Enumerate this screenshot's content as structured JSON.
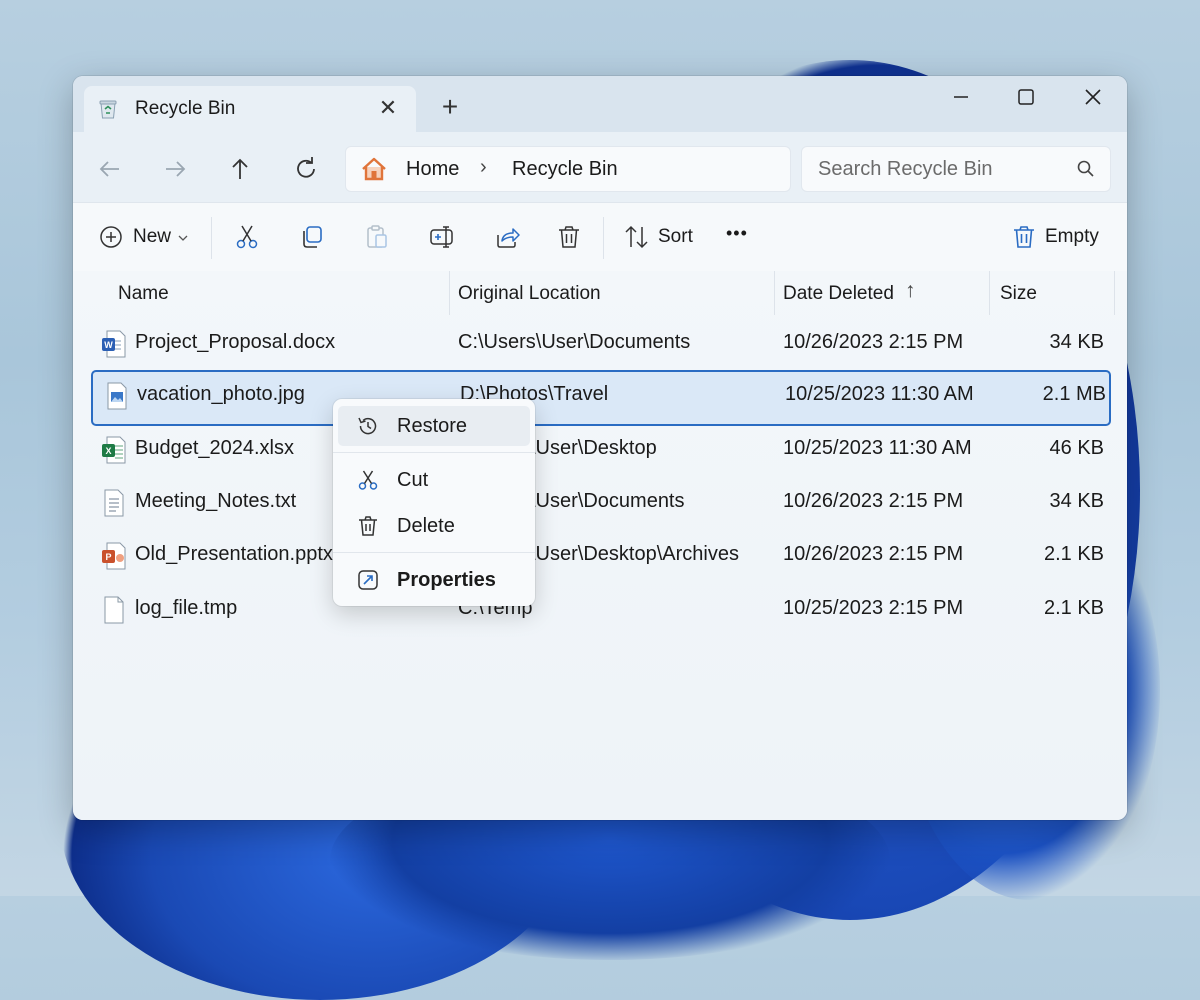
{
  "window": {
    "tab_title": "Recycle Bin",
    "tab_close": "✕",
    "new_tab": "+"
  },
  "address": {
    "crumbs": [
      "Home",
      "Recycle Bin"
    ],
    "separator": "›",
    "search_placeholder": "Search Recycle Bin"
  },
  "toolbar": {
    "new_label": "New",
    "sort_label": "Sort",
    "more_label": "•••",
    "empty_label": "Empty"
  },
  "columns": [
    "Name",
    "Original Location",
    "Date Deleted",
    "Size"
  ],
  "sort_indicator": "↑",
  "files": [
    {
      "name": "Project_Proposal.docx",
      "location": "C:\\Users\\User\\Documents",
      "date": "10/26/2023 2:15 PM",
      "size": "34 KB",
      "type": "word"
    },
    {
      "name": "vacation_photo.jpg",
      "location": "D:\\Photos\\Travel",
      "date": "10/25/2023 11:30 AM",
      "size": "2.1 MB",
      "type": "image",
      "selected": true
    },
    {
      "name": "Budget_2024.xlsx",
      "location": "\\User\\Desktop",
      "date": "10/25/2023 11:30 AM",
      "size": "46 KB",
      "type": "excel"
    },
    {
      "name": "Meeting_Notes.txt",
      "location": "\\User\\Documents",
      "date": "10/26/2023 2:15 PM",
      "size": "34 KB",
      "type": "text"
    },
    {
      "name": "Old_Presentation.pptx",
      "location": "\\User\\Desktop\\Archives",
      "date": "10/26/2023 2:15 PM",
      "size": "2.1 KB",
      "type": "powerpoint"
    },
    {
      "name": "log_file.tmp",
      "location": "C:\\Temp",
      "date": "10/25/2023 2:15 PM",
      "size": "2.1 KB",
      "type": "file"
    }
  ],
  "context_menu": {
    "items": [
      {
        "label": "Restore",
        "icon": "restore-icon"
      },
      {
        "label": "Cut",
        "icon": "cut-icon"
      },
      {
        "label": "Delete",
        "icon": "delete-icon"
      },
      {
        "label": "Properties",
        "icon": "properties-icon"
      }
    ]
  },
  "colors": {
    "accent": "#2a6cc3",
    "folder_home": "#e0743a",
    "excel": "#1e7b45",
    "word": "#2b5fb4",
    "powerpoint": "#c9512c"
  }
}
